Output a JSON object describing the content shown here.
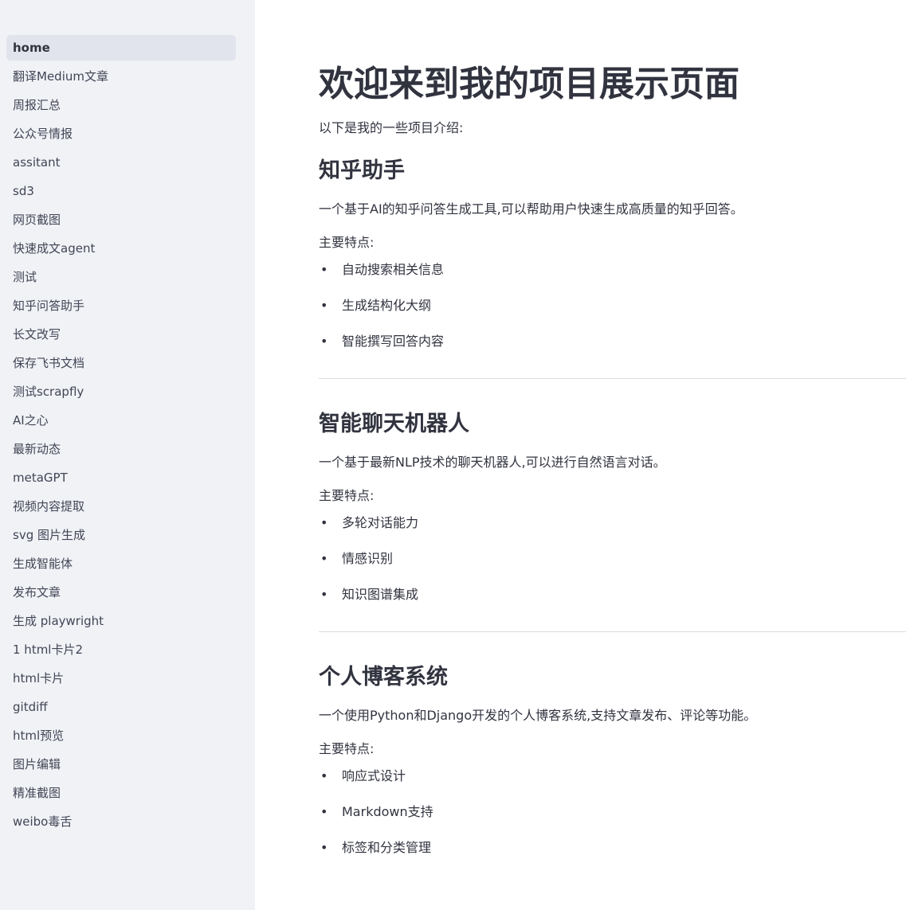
{
  "sidebar": {
    "items": [
      {
        "label": "home",
        "active": true
      },
      {
        "label": "翻译Medium文章"
      },
      {
        "label": "周报汇总"
      },
      {
        "label": "公众号情报"
      },
      {
        "label": "assitant"
      },
      {
        "label": "sd3"
      },
      {
        "label": "网页截图"
      },
      {
        "label": "快速成文agent"
      },
      {
        "label": "测试"
      },
      {
        "label": "知乎问答助手"
      },
      {
        "label": "长文改写"
      },
      {
        "label": "保存飞书文档"
      },
      {
        "label": "测试scrapfly"
      },
      {
        "label": "AI之心"
      },
      {
        "label": "最新动态"
      },
      {
        "label": "metaGPT"
      },
      {
        "label": "视频内容提取"
      },
      {
        "label": "svg 图片生成"
      },
      {
        "label": "生成智能体"
      },
      {
        "label": "发布文章"
      },
      {
        "label": "生成 playwright"
      },
      {
        "label": "1 html卡片2"
      },
      {
        "label": "html卡片"
      },
      {
        "label": "gitdiff"
      },
      {
        "label": "html预览"
      },
      {
        "label": "图片编辑"
      },
      {
        "label": "精准截图"
      },
      {
        "label": "weibo毒舌"
      }
    ]
  },
  "main": {
    "title": "欢迎来到我的项目展示页面",
    "intro": "以下是我的一些项目介绍:",
    "bullet": "•",
    "projects": [
      {
        "title": "知乎助手",
        "description": "一个基于AI的知乎问答生成工具,可以帮助用户快速生成高质量的知乎回答。",
        "features_label": "主要特点:",
        "features": [
          "自动搜索相关信息",
          "生成结构化大纲",
          "智能撰写回答内容"
        ]
      },
      {
        "title": "智能聊天机器人",
        "description": "一个基于最新NLP技术的聊天机器人,可以进行自然语言对话。",
        "features_label": "主要特点:",
        "features": [
          "多轮对话能力",
          "情感识别",
          "知识图谱集成"
        ]
      },
      {
        "title": "个人博客系统",
        "description": "一个使用Python和Django开发的个人博客系统,支持文章发布、评论等功能。",
        "features_label": "主要特点:",
        "features": [
          "响应式设计",
          "Markdown支持",
          "标签和分类管理"
        ]
      }
    ]
  },
  "colors": {
    "sidebar_bg": "#f0f2f6",
    "active_item_bg": "#e1e4ec",
    "text": "#31333f",
    "divider": "#dcdde2"
  }
}
